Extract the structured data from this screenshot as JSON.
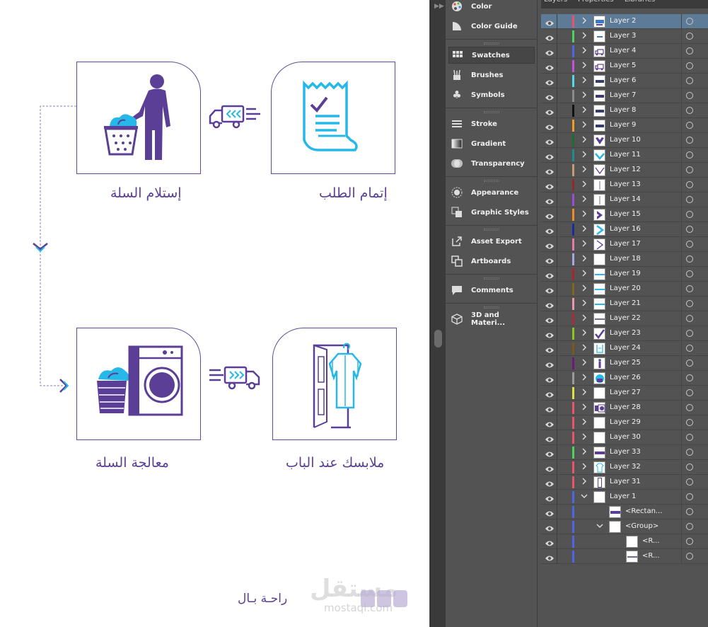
{
  "artboard": {
    "cards": [
      {
        "id": "receive-basket",
        "label": "إستلام السلة"
      },
      {
        "id": "complete-order",
        "label": "إتمام الطلب"
      },
      {
        "id": "process-basket",
        "label": "معالجة السلة"
      },
      {
        "id": "clothes-at-door",
        "label": "ملابسك عند الباب"
      }
    ],
    "brand": "راحـة بـال",
    "watermark": "مستقل",
    "watermark_sub": "mostaql.com",
    "colors": {
      "purple": "#5b3f96",
      "cyan": "#26b8e8",
      "border": "#5f4a99"
    }
  },
  "dock": {
    "groups": [
      [
        {
          "label": "Color",
          "icon": "palette-icon"
        },
        {
          "label": "Color Guide",
          "icon": "color-guide-icon"
        }
      ],
      [
        {
          "label": "Swatches",
          "icon": "swatches-icon",
          "active": true
        },
        {
          "label": "Brushes",
          "icon": "brushes-icon"
        },
        {
          "label": "Symbols",
          "icon": "symbols-icon"
        }
      ],
      [
        {
          "label": "Stroke",
          "icon": "stroke-icon"
        },
        {
          "label": "Gradient",
          "icon": "gradient-icon"
        },
        {
          "label": "Transparency",
          "icon": "transparency-icon"
        }
      ],
      [
        {
          "label": "Appearance",
          "icon": "appearance-icon"
        },
        {
          "label": "Graphic Styles",
          "icon": "graphic-styles-icon"
        }
      ],
      [
        {
          "label": "Asset Export",
          "icon": "asset-export-icon"
        },
        {
          "label": "Artboards",
          "icon": "artboards-icon"
        }
      ],
      [
        {
          "label": "Comments",
          "icon": "comments-icon"
        }
      ],
      [
        {
          "label": "3D and Materi...",
          "icon": "cube-icon"
        }
      ]
    ]
  },
  "layers_panel": {
    "tabs": [
      "Layers",
      "Properties",
      "Libraries"
    ],
    "rows": [
      {
        "name": "Layer 2",
        "color": "#e8546a",
        "thumb": "text-blue",
        "selected": true
      },
      {
        "name": "Layer 3",
        "color": "#4dd35b",
        "thumb": "text-small"
      },
      {
        "name": "Layer 4",
        "color": "#4d66e8",
        "thumb": "truck"
      },
      {
        "name": "Layer 5",
        "color": "#c350e0",
        "thumb": "truck"
      },
      {
        "name": "Layer 6",
        "color": "#56d7e6",
        "thumb": "text-dark"
      },
      {
        "name": "Layer 7",
        "color": "#8a8a8a",
        "thumb": "text-dark"
      },
      {
        "name": "Layer 8",
        "color": "#111111",
        "thumb": "text-dark"
      },
      {
        "name": "Layer 9",
        "color": "#f29b21",
        "thumb": "text-dark"
      },
      {
        "name": "Layer 10",
        "color": "#1b6e2e",
        "thumb": "heart-purple"
      },
      {
        "name": "Layer 11",
        "color": "#1f8d8d",
        "thumb": "check-cyan"
      },
      {
        "name": "Layer 12",
        "color": "#c49a78",
        "thumb": "check-outline"
      },
      {
        "name": "Layer 13",
        "color": "#8c2d2d",
        "thumb": "vline"
      },
      {
        "name": "Layer 14",
        "color": "#9b4dd8",
        "thumb": "vline"
      },
      {
        "name": "Layer 15",
        "color": "#f08a24",
        "thumb": "chevron-purple"
      },
      {
        "name": "Layer 16",
        "color": "#1d2b9c",
        "thumb": "chevron-cyan"
      },
      {
        "name": "Layer 17",
        "color": "#e87aa8",
        "thumb": "chevron-outline"
      },
      {
        "name": "Layer 18",
        "color": "#a8a8e0",
        "thumb": "blank"
      },
      {
        "name": "Layer 19",
        "color": "#a8262e",
        "thumb": "hline-cyan"
      },
      {
        "name": "Layer 20",
        "color": "#7a6a1a",
        "thumb": "hline-cyan"
      },
      {
        "name": "Layer 21",
        "color": "#e898b0",
        "thumb": "hline-cyan"
      },
      {
        "name": "Layer 22",
        "color": "#a82c3c",
        "thumb": "hline-dark"
      },
      {
        "name": "Layer 23",
        "color": "#8ac820",
        "thumb": "check-purple"
      },
      {
        "name": "Layer 24",
        "color": "#7a5a1a",
        "thumb": "receipt"
      },
      {
        "name": "Layer 25",
        "color": "#6a1a7a",
        "thumb": "person"
      },
      {
        "name": "Layer 26",
        "color": "#9a9a9a",
        "thumb": "basket"
      },
      {
        "name": "Layer 27",
        "color": "#e0e040",
        "thumb": "blank"
      },
      {
        "name": "Layer 28",
        "color": "#e8546a",
        "thumb": "washer"
      },
      {
        "name": "Layer 29",
        "color": "#e8546a",
        "thumb": "blank"
      },
      {
        "name": "Layer 30",
        "color": "#e8546a",
        "thumb": "blank"
      },
      {
        "name": "Layer 33",
        "color": "#4dd35b",
        "thumb": "bar-purple"
      },
      {
        "name": "Layer 32",
        "color": "#e8546a",
        "thumb": "robe"
      },
      {
        "name": "Layer 31",
        "color": "#e8546a",
        "thumb": "door"
      },
      {
        "name": "Layer 1",
        "color": "#4d66e8",
        "thumb": "blank",
        "expanded": true
      },
      {
        "name": "<Rectan...",
        "color": "#4d66e8",
        "thumb": "bar-purple",
        "indent": 1
      },
      {
        "name": "<Group>",
        "color": "#4d66e8",
        "thumb": "blank",
        "indent": 1,
        "expanded": true
      },
      {
        "name": "<R...",
        "color": "#4d66e8",
        "thumb": "blank",
        "indent": 2
      },
      {
        "name": "<R...",
        "color": "#4d66e8",
        "thumb": "hline-dark",
        "indent": 2
      }
    ]
  }
}
